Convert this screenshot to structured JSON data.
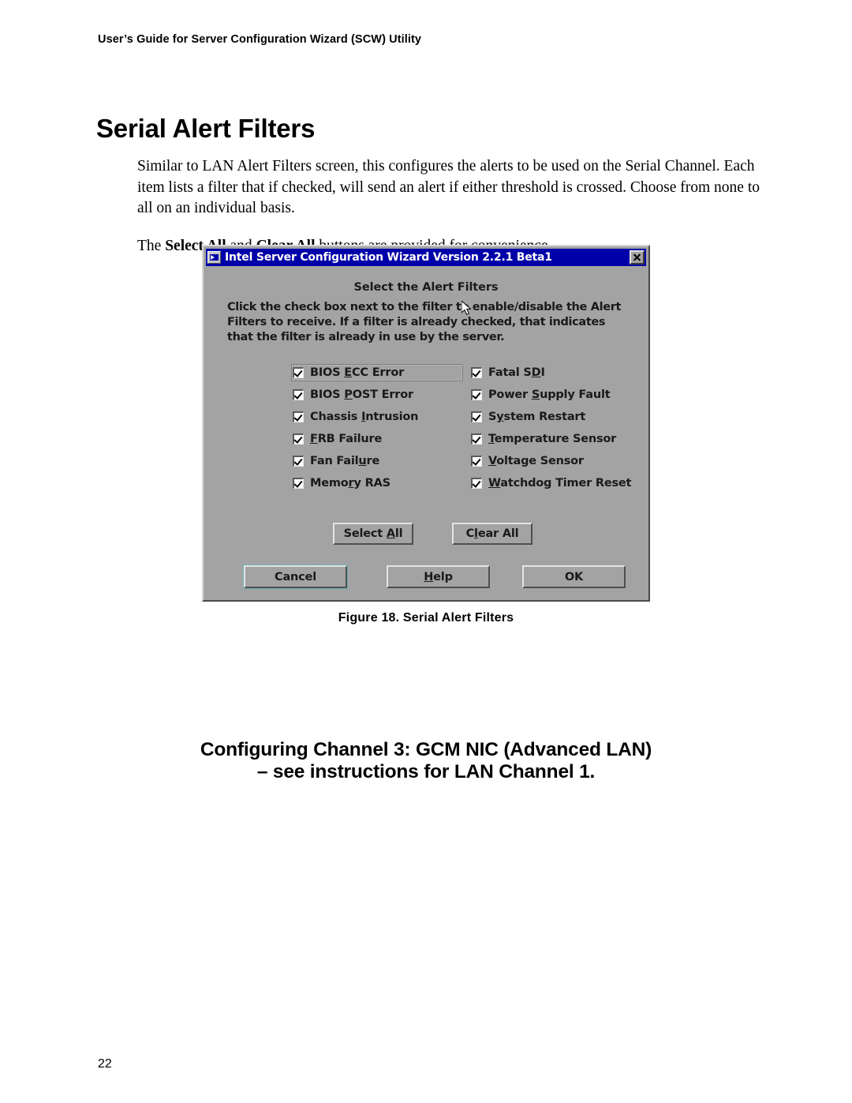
{
  "document": {
    "running_header": "User’s Guide for Server Configuration Wizard (SCW) Utility",
    "page_title": "Serial Alert Filters",
    "paragraph_1": "Similar to LAN Alert Filters screen, this configures the alerts to be used on the Serial Channel. Each item lists a filter that if checked, will send an alert if either threshold is crossed.  Choose from none to all on an individual basis.",
    "paragraph_2_prefix": "The ",
    "paragraph_2_bold_1": "Select All",
    "paragraph_2_mid": " and ",
    "paragraph_2_bold_2": "Clear All",
    "paragraph_2_suffix": " buttons are provided for convenience.",
    "figure_caption": "Figure 18.  Serial Alert Filters",
    "section_heading_line1": "Configuring Channel 3:  GCM NIC (Advanced LAN)",
    "section_heading_line2": "– see instructions for LAN Channel 1.",
    "page_number": "22"
  },
  "dialog": {
    "titlebar": {
      "title": "Intel Server Configuration Wizard Version 2.2.1 Beta1",
      "icon": "intel-wizard-icon",
      "close_label": "×"
    },
    "heading": "Select the Alert Filters",
    "instructions": "Click the check box next to the filter to enable/disable the Alert Filters to receive. If a filter is already checked, that indicates that the filter is already in use by the server.",
    "filters_left": [
      {
        "label_pre": "BIOS ",
        "mnemonic": "E",
        "label_post": "CC Error",
        "checked": true,
        "focused": true
      },
      {
        "label_pre": "BIOS ",
        "mnemonic": "P",
        "label_post": "OST Error",
        "checked": true,
        "focused": false
      },
      {
        "label_pre": "Chassis ",
        "mnemonic": "I",
        "label_post": "ntrusion",
        "checked": true,
        "focused": false
      },
      {
        "label_pre": "",
        "mnemonic": "F",
        "label_post": "RB Failure",
        "checked": true,
        "focused": false
      },
      {
        "label_pre": "Fan Fail",
        "mnemonic": "u",
        "label_post": "re",
        "checked": true,
        "focused": false
      },
      {
        "label_pre": "Memo",
        "mnemonic": "r",
        "label_post": "y RAS",
        "checked": true,
        "focused": false
      }
    ],
    "filters_right": [
      {
        "label_pre": "Fatal S",
        "mnemonic": "D",
        "label_post": "I",
        "checked": true,
        "focused": false
      },
      {
        "label_pre": "Power ",
        "mnemonic": "S",
        "label_post": "upply Fault",
        "checked": true,
        "focused": false
      },
      {
        "label_pre": "S",
        "mnemonic": "y",
        "label_post": "stem Restart",
        "checked": true,
        "focused": false
      },
      {
        "label_pre": "",
        "mnemonic": "T",
        "label_post": "emperature Sensor",
        "checked": true,
        "focused": false
      },
      {
        "label_pre": "",
        "mnemonic": "V",
        "label_post": "oltage Sensor",
        "checked": true,
        "focused": false
      },
      {
        "label_pre": "",
        "mnemonic": "W",
        "label_post": "atchdog Timer Reset",
        "checked": true,
        "focused": false
      }
    ],
    "buttons": {
      "select_all_pre": "Select ",
      "select_all_mnemonic": "A",
      "select_all_post": "ll",
      "clear_all_pre": "C",
      "clear_all_mnemonic": "l",
      "clear_all_post": "ear All",
      "cancel": "Cancel",
      "help_pre": "",
      "help_mnemonic": "H",
      "help_post": "elp",
      "ok": "OK"
    }
  },
  "colors": {
    "titlebar_blue": "#0000a8",
    "dialog_face": "#a3a3a3",
    "text_black": "#000000",
    "page_background": "#ffffff"
  }
}
